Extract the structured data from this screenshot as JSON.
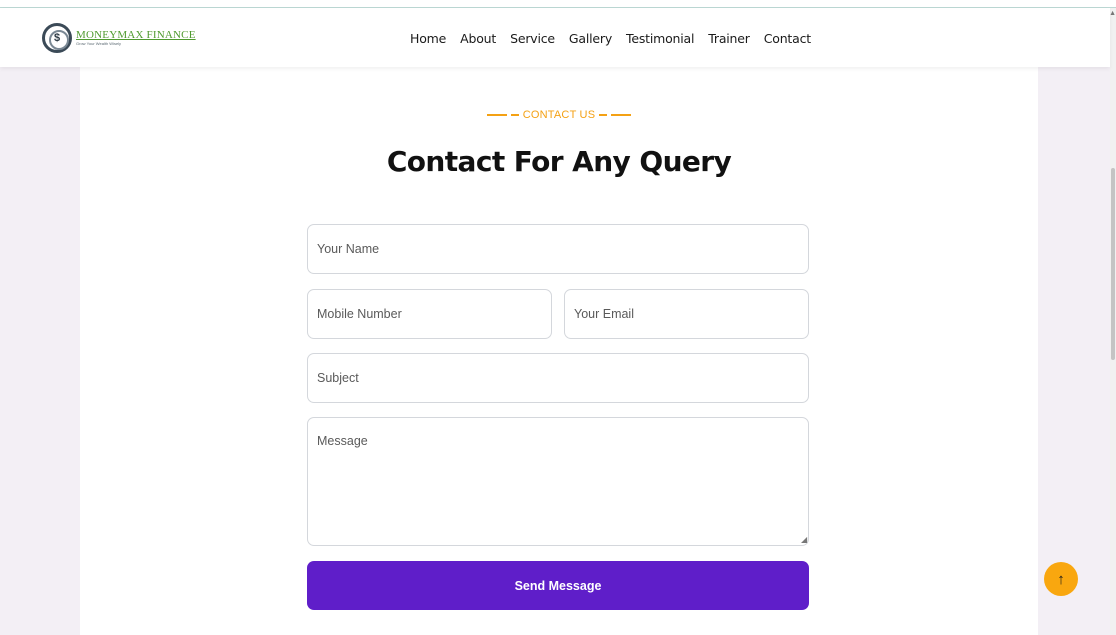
{
  "brand": {
    "name": "MONEYMAX FINANCE",
    "tagline": "Grow Your Wealth Wisely",
    "logo_glyph": "$",
    "name_color": "#4f9a2f"
  },
  "nav": {
    "items": [
      "Home",
      "About",
      "Service",
      "Gallery",
      "Testimonial",
      "Trainer",
      "Contact"
    ]
  },
  "contact": {
    "eyebrow": "CONTACT US",
    "heading": "Contact For Any Query",
    "fields": {
      "name_placeholder": "Your Name",
      "mobile_placeholder": "Mobile Number",
      "email_placeholder": "Your Email",
      "subject_placeholder": "Subject",
      "message_placeholder": "Message"
    },
    "submit_label": "Send Message"
  },
  "back_to_top": {
    "icon": "arrow-up-icon",
    "glyph": "↑"
  },
  "colors": {
    "accent": "#f4a114",
    "button": "#5f1ec9",
    "back_to_top": "#f9a70f",
    "page_background": "#f3eff5"
  }
}
